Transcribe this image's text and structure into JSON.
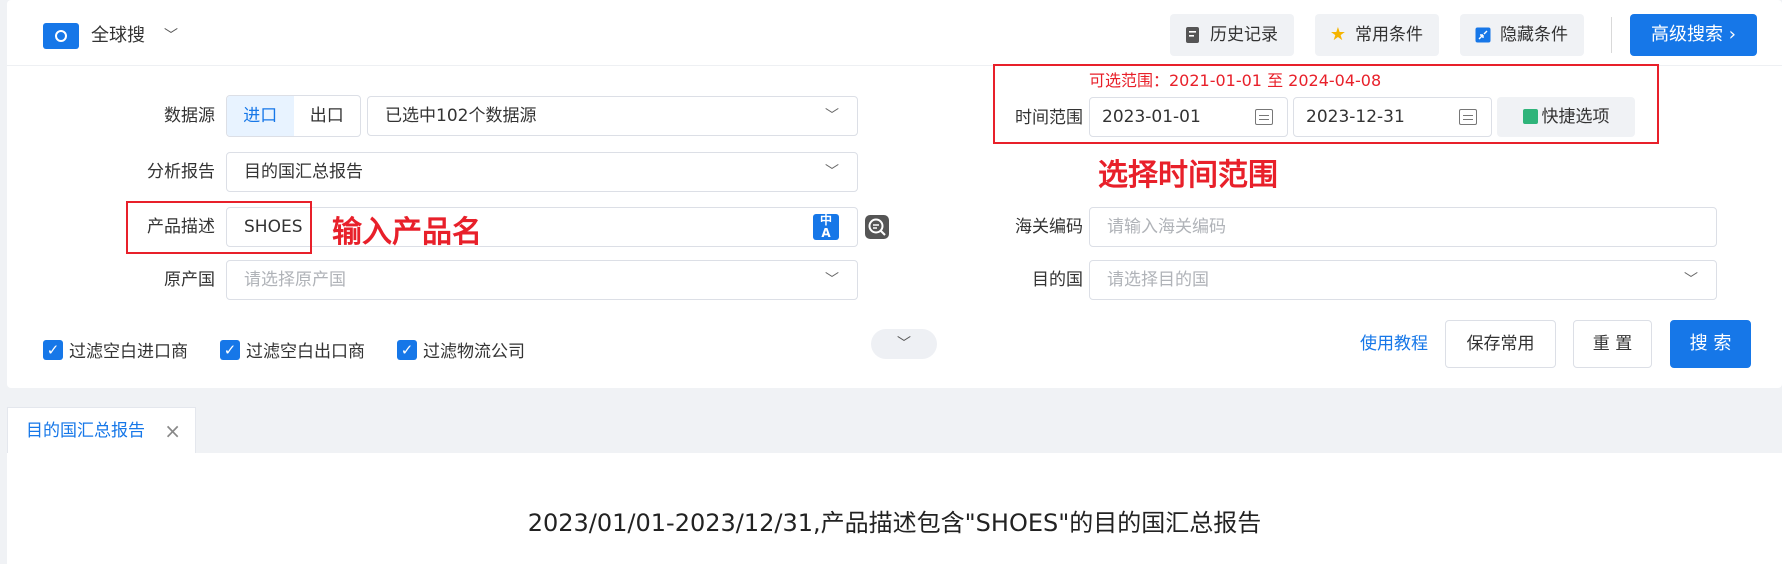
{
  "header": {
    "brand": "全球搜",
    "history": "历史记录",
    "favorites": "常用条件",
    "hide": "隐藏条件",
    "advanced": "高级搜索 ›"
  },
  "form": {
    "datasource_label": "数据源",
    "import": "进口",
    "export": "出口",
    "datasource_value": "已选中102个数据源",
    "report_label": "分析报告",
    "report_value": "目的国汇总报告",
    "product_label": "产品描述",
    "product_value": "SHOES",
    "origin_label": "原产国",
    "origin_placeholder": "请选择原产国",
    "time_label": "时间范围",
    "range_hint": "可选范围：2021-01-01 至 2024-04-08",
    "start_date": "2023-01-01",
    "end_date": "2023-12-31",
    "quick": "快捷选项",
    "hs_label": "海关编码",
    "hs_placeholder": "请输入海关编码",
    "dest_label": "目的国",
    "dest_placeholder": "请选择目的国"
  },
  "annotations": {
    "product_hint": "输入产品名",
    "time_hint": "选择时间范围"
  },
  "filters": [
    "过滤空白进口商",
    "过滤空白出口商",
    "过滤物流公司"
  ],
  "actions": {
    "tutorial": "使用教程",
    "save": "保存常用",
    "reset": "重 置",
    "search": "搜 索"
  },
  "tab": {
    "label": "目的国汇总报告",
    "close": "×"
  },
  "report": {
    "title": "2023/01/01-2023/12/31,产品描述包含\"SHOES\"的目的国汇总报告"
  },
  "colors": {
    "primary": "#1677e8",
    "annotation": "#e8202a"
  }
}
